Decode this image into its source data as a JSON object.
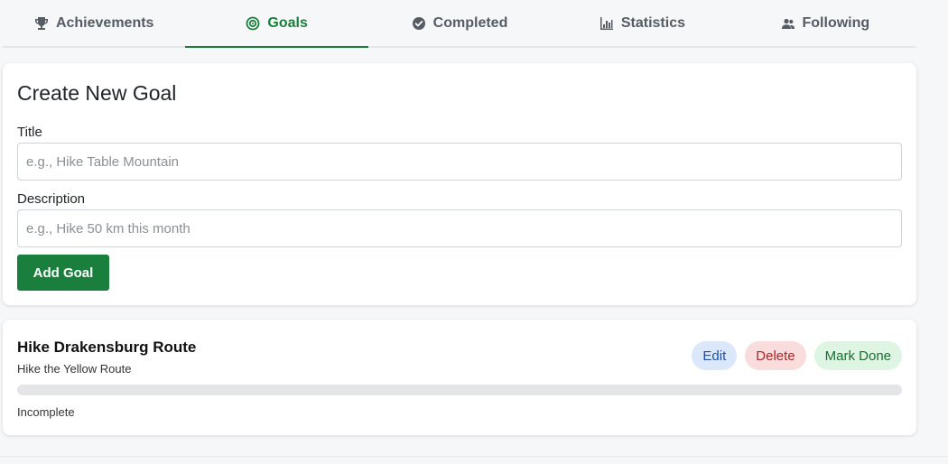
{
  "tabs": [
    {
      "label": "Achievements",
      "icon": "trophy-icon",
      "active": false
    },
    {
      "label": "Goals",
      "icon": "target-icon",
      "active": true
    },
    {
      "label": "Completed",
      "icon": "check-circle-icon",
      "active": false
    },
    {
      "label": "Statistics",
      "icon": "bar-chart-icon",
      "active": false
    },
    {
      "label": "Following",
      "icon": "users-icon",
      "active": false
    }
  ],
  "form": {
    "title": "Create New Goal",
    "title_label": "Title",
    "title_placeholder": "e.g., Hike Table Mountain",
    "description_label": "Description",
    "description_placeholder": "e.g., Hike 50 km this month",
    "submit_label": "Add Goal"
  },
  "goals": [
    {
      "title": "Hike Drakensburg Route",
      "description": "Hike the Yellow Route",
      "progress": 0,
      "status": "Incomplete",
      "edit_label": "Edit",
      "delete_label": "Delete",
      "done_label": "Mark Done"
    }
  ],
  "colors": {
    "accent": "#1a7f3c",
    "edit_bg": "#dbe8fb",
    "delete_bg": "#f9dcdc",
    "done_bg": "#ddf5e2"
  }
}
